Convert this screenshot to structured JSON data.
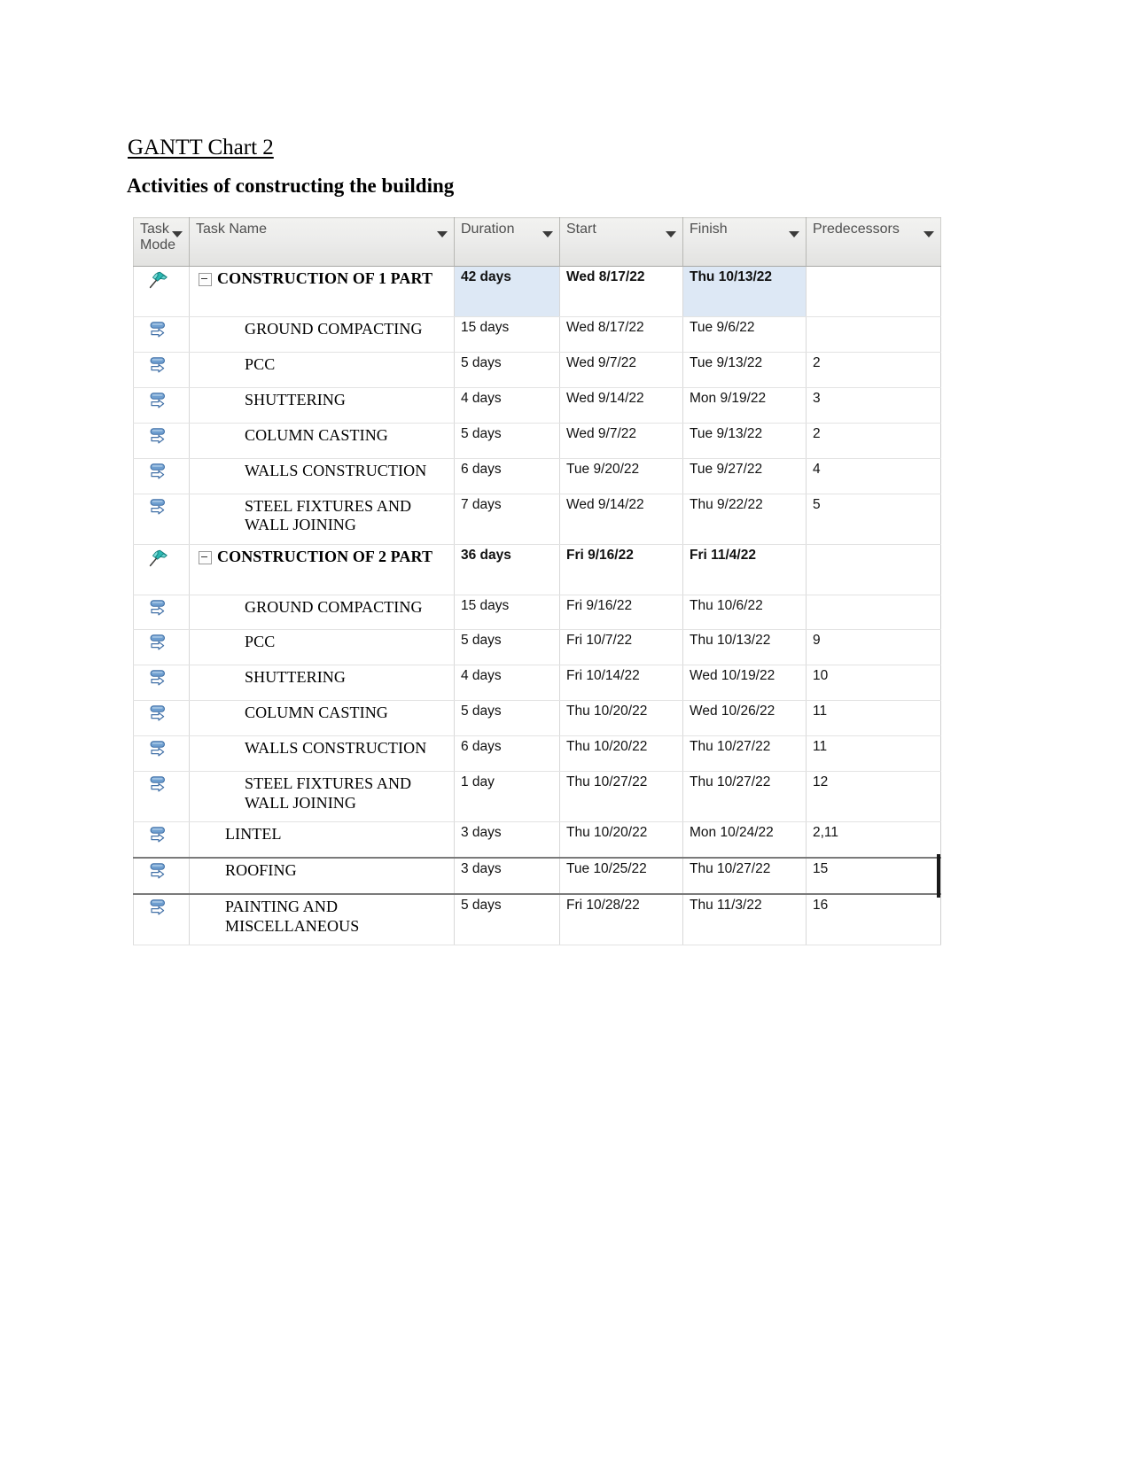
{
  "document": {
    "title": "GANTT Chart 2",
    "subtitle": "Activities of constructing the building"
  },
  "table": {
    "columns": [
      {
        "id": "mode",
        "label": "Task Mode",
        "has_filter": true
      },
      {
        "id": "name",
        "label": "Task Name",
        "has_filter": true
      },
      {
        "id": "dur",
        "label": "Duration",
        "has_filter": true
      },
      {
        "id": "start",
        "label": "Start",
        "has_filter": true
      },
      {
        "id": "fin",
        "label": "Finish",
        "has_filter": true
      },
      {
        "id": "pred",
        "label": "Predecessors",
        "has_filter": true
      }
    ],
    "rows": [
      {
        "mode_icon": "pushpin-icon",
        "name": "CONSTRUCTION OF 1 PART",
        "duration": "42 days",
        "start": "Wed 8/17/22",
        "finish": "Thu 10/13/22",
        "predecessors": ""
      },
      {
        "mode_icon": "auto-schedule-icon",
        "name": "GROUND COMPACTING",
        "duration": "15 days",
        "start": "Wed 8/17/22",
        "finish": "Tue 9/6/22",
        "predecessors": ""
      },
      {
        "mode_icon": "auto-schedule-icon",
        "name": "PCC",
        "duration": "5 days",
        "start": "Wed 9/7/22",
        "finish": "Tue 9/13/22",
        "predecessors": "2"
      },
      {
        "mode_icon": "auto-schedule-icon",
        "name": "SHUTTERING",
        "duration": "4 days",
        "start": "Wed 9/14/22",
        "finish": "Mon 9/19/22",
        "predecessors": "3"
      },
      {
        "mode_icon": "auto-schedule-icon",
        "name": "COLUMN CASTING",
        "duration": "5 days",
        "start": "Wed 9/7/22",
        "finish": "Tue 9/13/22",
        "predecessors": "2"
      },
      {
        "mode_icon": "auto-schedule-icon",
        "name": "WALLS CONSTRUCTION",
        "duration": "6 days",
        "start": "Tue 9/20/22",
        "finish": "Tue 9/27/22",
        "predecessors": "4"
      },
      {
        "mode_icon": "auto-schedule-icon",
        "name": "STEEL FIXTURES AND WALL JOINING",
        "duration": "7 days",
        "start": "Wed 9/14/22",
        "finish": "Thu 9/22/22",
        "predecessors": "5"
      },
      {
        "mode_icon": "pushpin-icon",
        "name": "CONSTRUCTION OF  2 PART",
        "duration": "36 days",
        "start": "Fri 9/16/22",
        "finish": "Fri 11/4/22",
        "predecessors": ""
      },
      {
        "mode_icon": "auto-schedule-icon",
        "name": "GROUND COMPACTING",
        "duration": "15 days",
        "start": "Fri 9/16/22",
        "finish": "Thu 10/6/22",
        "predecessors": ""
      },
      {
        "mode_icon": "auto-schedule-icon",
        "name": "PCC",
        "duration": "5 days",
        "start": "Fri 10/7/22",
        "finish": "Thu 10/13/22",
        "predecessors": "9"
      },
      {
        "mode_icon": "auto-schedule-icon",
        "name": "SHUTTERING",
        "duration": "4 days",
        "start": "Fri 10/14/22",
        "finish": "Wed 10/19/22",
        "predecessors": "10"
      },
      {
        "mode_icon": "auto-schedule-icon",
        "name": "COLUMN CASTING",
        "duration": "5 days",
        "start": "Thu 10/20/22",
        "finish": "Wed 10/26/22",
        "predecessors": "11"
      },
      {
        "mode_icon": "auto-schedule-icon",
        "name": "WALLS CONSTRUCTION",
        "duration": "6 days",
        "start": "Thu 10/20/22",
        "finish": "Thu 10/27/22",
        "predecessors": "11"
      },
      {
        "mode_icon": "auto-schedule-icon",
        "name": "STEEL FIXTURES AND WALL JOINING",
        "duration": "1 day",
        "start": "Thu 10/27/22",
        "finish": "Thu 10/27/22",
        "predecessors": "12"
      },
      {
        "mode_icon": "auto-schedule-icon",
        "name": "LINTEL",
        "duration": "3 days",
        "start": "Thu 10/20/22",
        "finish": "Mon 10/24/22",
        "predecessors": "2,11"
      },
      {
        "mode_icon": "auto-schedule-icon",
        "name": "ROOFING",
        "duration": "3 days",
        "start": "Tue 10/25/22",
        "finish": "Thu 10/27/22",
        "predecessors": "15"
      },
      {
        "mode_icon": "auto-schedule-icon",
        "name": "PAINTING AND MISCELLANEOUS",
        "duration": "5 days",
        "start": "Fri 10/28/22",
        "finish": "Thu 11/3/22",
        "predecessors": "16"
      }
    ]
  },
  "colors": {
    "header_bg": "#ebebe9",
    "header_text": "#4f4f4f",
    "highlight_cell": "#dde8f5",
    "pushpin_teal": "#23b0ad",
    "auto_icon_blue": "#4f81bd",
    "selection_border": "#7a7a7a"
  }
}
